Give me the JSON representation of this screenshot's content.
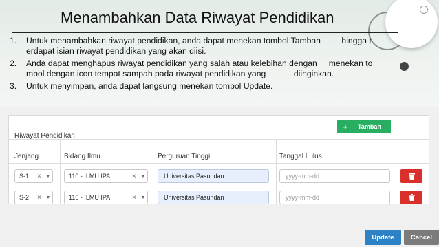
{
  "slide": {
    "title": "Menambahkan Data Riwayat Pendidikan",
    "steps": [
      {
        "num": "1.",
        "text": "Untuk menambahkan riwayat pendidikan, anda dapat menekan tombol Tambah         hingga t\nerdapat isian riwayat pendidikan yang akan diisi."
      },
      {
        "num": "2.",
        "text": "Anda dapat menghapus riwayat pendidikan yang salah atau kelebihan dengan     menekan to\nmbol dengan icon tempat sampah pada riwayat pendidikan yang            diinginkan."
      },
      {
        "num": "3.",
        "text": "Untuk menyimpan, anda dapat langsung menekan tombol Update."
      }
    ]
  },
  "form": {
    "section_title": "Riwayat Pendidikan",
    "add_button": {
      "icon": "plus-icon",
      "label": "Tambah"
    },
    "columns": {
      "jenjang": "Jenjang",
      "bidang_ilmu": "Bidang Ilmu",
      "perguruan_tinggi": "Perguruan Tinggi",
      "tanggal_lulus": "Tanggal Lulus"
    },
    "rows": [
      {
        "jenjang": "S-1",
        "bidang_ilmu": "110 - ILMU IPA",
        "perguruan_tinggi": "Universitas Pasundan",
        "tanggal_lulus_placeholder": "yyyy-mm-dd",
        "clear_glyph": "×",
        "caret_glyph": "▼"
      },
      {
        "jenjang": "S-2",
        "bidang_ilmu": "110 - ILMU IPA",
        "perguruan_tinggi": "Universitas Pasundan",
        "tanggal_lulus_placeholder": "yyyy-mm-dd",
        "clear_glyph": "×",
        "caret_glyph": "▼"
      }
    ],
    "update_label": "Update",
    "cancel_label": "Cancel"
  },
  "colors": {
    "add_green": "#27ae60",
    "delete_red": "#d9302c",
    "update_blue": "#2d82c6",
    "cancel_gray": "#7b7b7b",
    "filled_input": "#e6effb"
  }
}
